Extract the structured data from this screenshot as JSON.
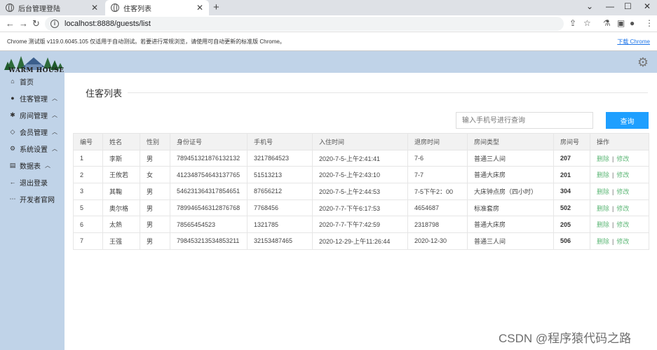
{
  "browser": {
    "tabs": [
      {
        "title": "后台管理登陆",
        "active": false
      },
      {
        "title": "住客列表",
        "active": true
      }
    ],
    "new_tab": "+",
    "url": "localhost:8888/guests/list",
    "infobar_text": "Chrome 测试版 v119.0.6045.105 仅适用于自动测试。若要进行常规浏览，请使用可自动更新的标准版 Chrome。",
    "infobar_link": "下载 Chrome"
  },
  "logo": {
    "text": "WARM HOUSE"
  },
  "sidebar": {
    "items": [
      {
        "label": "首页",
        "icon": "home-icon",
        "has_chevron": false
      },
      {
        "label": "住客管理",
        "icon": "user-icon",
        "has_chevron": true
      },
      {
        "label": "房间管理",
        "icon": "bed-icon",
        "has_chevron": true
      },
      {
        "label": "会员管理",
        "icon": "diamond-icon",
        "has_chevron": true
      },
      {
        "label": "系统设置",
        "icon": "gear-icon",
        "has_chevron": true
      },
      {
        "label": "数据表",
        "icon": "table-icon",
        "has_chevron": true
      },
      {
        "label": "退出登录",
        "icon": "arrow-left-icon",
        "has_chevron": false
      },
      {
        "label": "开发者官网",
        "icon": "more-icon",
        "has_chevron": false
      }
    ]
  },
  "main": {
    "title": "住客列表",
    "search": {
      "placeholder": "输入手机号进行查询",
      "button": "查询"
    },
    "columns": [
      "编号",
      "姓名",
      "性别",
      "身份证号",
      "手机号",
      "入住时间",
      "退房时间",
      "房间类型",
      "房间号",
      "操作"
    ],
    "rows": [
      {
        "id": "1",
        "name": "李斯",
        "gender": "男",
        "idcard": "789451321876132132",
        "phone": "3217864523",
        "checkin": "2020-7-5-上午2:41:41",
        "checkout": "7-6",
        "room_type": "普通三人间",
        "room": "207"
      },
      {
        "id": "2",
        "name": "王攸若",
        "gender": "女",
        "idcard": "412348754643137765",
        "phone": "51513213",
        "checkin": "2020-7-5-上午2:43:10",
        "checkout": "7-7",
        "room_type": "普通大床房",
        "room": "201"
      },
      {
        "id": "3",
        "name": "其鞠",
        "gender": "男",
        "idcard": "546231364317854651",
        "phone": "87656212",
        "checkin": "2020-7-5-上午2:44:53",
        "checkout": "7-5下午2：00",
        "room_type": "大床钟点房（四小时）",
        "room": "304"
      },
      {
        "id": "5",
        "name": "奥尔格",
        "gender": "男",
        "idcard": "789946546312876768",
        "phone": "7768456",
        "checkin": "2020-7-7-下午6:17:53",
        "checkout": "4654687",
        "room_type": "标准套房",
        "room": "502"
      },
      {
        "id": "6",
        "name": "太熱",
        "gender": "男",
        "idcard": "78565454523",
        "phone": "1321785",
        "checkin": "2020-7-7-下午7:42:59",
        "checkout": "2318798",
        "room_type": "普通大床房",
        "room": "205"
      },
      {
        "id": "7",
        "name": "王强",
        "gender": "男",
        "idcard": "798453213534853211",
        "phone": "32153487465",
        "checkin": "2020-12-29-上午11:26:44",
        "checkout": "2020-12-30",
        "room_type": "普通三人间",
        "room": "506"
      }
    ],
    "actions": {
      "delete": "删除",
      "separator": "|",
      "edit": "修改"
    }
  },
  "watermark": "CSDN @程序猿代码之路",
  "colors": {
    "sidebar_bg": "#c0d3e8",
    "search_button": "#1e9fff",
    "action_link": "#5fb878"
  }
}
